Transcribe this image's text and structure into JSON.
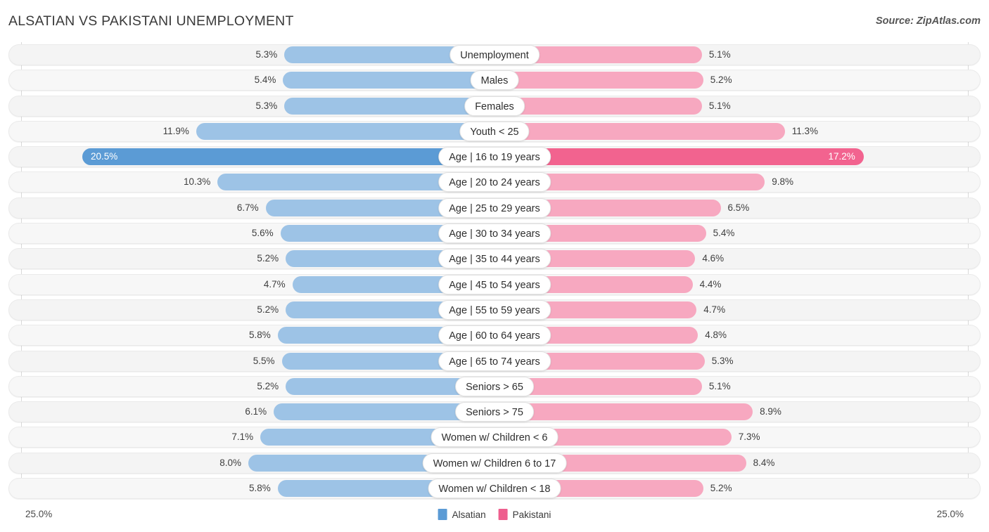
{
  "header": {
    "title": "ALSATIAN VS PAKISTANI UNEMPLOYMENT",
    "source": "Source: ZipAtlas.com"
  },
  "legend": {
    "items": [
      {
        "label": "Alsatian",
        "color": "#5b9bd5"
      },
      {
        "label": "Pakistani",
        "color": "#ee5f8e"
      }
    ]
  },
  "axis": {
    "min_label": "25.0%",
    "max_label": "25.0%"
  },
  "colors": {
    "left_normal": "#9dc3e6",
    "left_highlight": "#5b9bd5",
    "right_normal": "#f7a8c0",
    "right_highlight": "#f2638f",
    "track": "#f4f4f4",
    "gridline": "#d9d9d9"
  },
  "chart_data": {
    "type": "bar",
    "title": "ALSATIAN VS PAKISTANI UNEMPLOYMENT",
    "subtitle": "Source: ZipAtlas.com",
    "orientation": "horizontal-diverging",
    "xlabel": "",
    "ylabel": "",
    "xlim": [
      25.0,
      25.0
    ],
    "grid": true,
    "legend_position": "bottom-center",
    "categories": [
      "Unemployment",
      "Males",
      "Females",
      "Youth < 25",
      "Age | 16 to 19 years",
      "Age | 20 to 24 years",
      "Age | 25 to 29 years",
      "Age | 30 to 34 years",
      "Age | 35 to 44 years",
      "Age | 45 to 54 years",
      "Age | 55 to 59 years",
      "Age | 60 to 64 years",
      "Age | 65 to 74 years",
      "Seniors > 65",
      "Seniors > 75",
      "Women w/ Children < 6",
      "Women w/ Children 6 to 17",
      "Women w/ Children < 18"
    ],
    "series": [
      {
        "name": "Alsatian",
        "side": "left",
        "values": [
          5.3,
          5.4,
          5.3,
          11.9,
          20.5,
          10.3,
          6.7,
          5.6,
          5.2,
          4.7,
          5.2,
          5.8,
          5.5,
          5.2,
          6.1,
          7.1,
          8.0,
          5.8
        ],
        "labels": [
          "5.3%",
          "5.4%",
          "5.3%",
          "11.9%",
          "20.5%",
          "10.3%",
          "6.7%",
          "5.6%",
          "5.2%",
          "4.7%",
          "5.2%",
          "5.8%",
          "5.5%",
          "5.2%",
          "6.1%",
          "7.1%",
          "8.0%",
          "5.8%"
        ]
      },
      {
        "name": "Pakistani",
        "side": "right",
        "values": [
          5.1,
          5.2,
          5.1,
          11.3,
          17.2,
          9.8,
          6.5,
          5.4,
          4.6,
          4.4,
          4.7,
          4.8,
          5.3,
          5.1,
          8.9,
          7.3,
          8.4,
          5.2
        ],
        "labels": [
          "5.1%",
          "5.2%",
          "5.1%",
          "11.3%",
          "17.2%",
          "9.8%",
          "6.5%",
          "5.4%",
          "4.6%",
          "4.4%",
          "4.7%",
          "4.8%",
          "5.3%",
          "5.1%",
          "8.9%",
          "7.3%",
          "8.4%",
          "5.2%"
        ]
      }
    ],
    "highlighted_row_index": 4
  }
}
